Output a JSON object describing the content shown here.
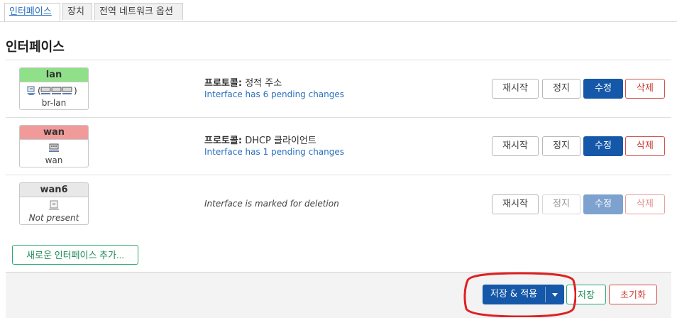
{
  "tabs": [
    "인터페이스",
    "장치",
    "전역 네트워크 옵션"
  ],
  "page_title": "인터페이스",
  "interfaces": [
    {
      "name": "lan",
      "header_color": "#90e08a",
      "device": "br-lan",
      "protocol_label": "프로토콜:",
      "protocol_value": "정적 주소",
      "status": "Interface has 6 pending changes"
    },
    {
      "name": "wan",
      "header_color": "#f09a9a",
      "device": "wan",
      "protocol_label": "프로토콜:",
      "protocol_value": "DHCP 클라이언트",
      "status": "Interface has 1 pending changes"
    },
    {
      "name": "wan6",
      "header_color": "#e8e8e8",
      "device": "Not present",
      "status": "Interface is marked for deletion"
    }
  ],
  "buttons": {
    "restart": "재시작",
    "stop": "정지",
    "edit": "수정",
    "delete": "삭제"
  },
  "add_interface": "새로운 인터페이스 추가...",
  "footer": {
    "save_apply": "저장 & 적용",
    "save": "저장",
    "reset": "초기화"
  },
  "colors": {
    "primary": "#1557a8",
    "positive": "#2aa86f",
    "negative": "#d0524a",
    "link": "#2a6fbd",
    "highlight": "#e02020"
  }
}
